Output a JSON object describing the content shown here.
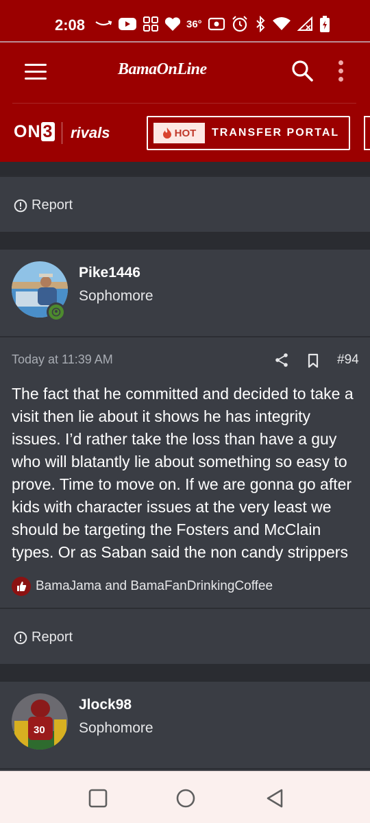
{
  "status_bar": {
    "time": "2:08",
    "temperature": "36°",
    "icons": [
      "amazon-icon",
      "youtube-icon",
      "apps-icon",
      "heart-icon",
      "temperature",
      "radio-icon",
      "alarm-icon",
      "bluetooth-icon",
      "wifi-icon",
      "signal-icon",
      "battery-icon"
    ]
  },
  "header": {
    "brand": "BamaOnLine",
    "on3_logo": "ON",
    "on3_logo_suffix": "3",
    "rivals_logo": "rivals",
    "hot_badge": "HOT",
    "transfer_portal_label": "TRANSFER PORTAL"
  },
  "report_label": "Report",
  "posts": [
    {
      "username": "Pike1446",
      "user_title": "Sophomore",
      "timestamp": "Today at 11:39 AM",
      "post_number": "#94",
      "body": "The fact that he committed and decided to take a visit then lie about it shows he has integrity issues. I’d rather take the loss than have a guy who will blatantly lie about something so easy to prove. Time to move on. If we are gonna go after kids with character issues at the very least we should be targeting the Fosters and McClain types. Or as Saban said the non candy strippers",
      "reactions_text": "BamaJama and BamaFanDrinkingCoffee"
    },
    {
      "username": "Jlock98",
      "user_title": "Sophomore",
      "jersey_number": "30"
    }
  ],
  "colors": {
    "brand_red": "#9b0000",
    "card_bg": "#3a3d44",
    "page_bg": "#2f3238",
    "online_green": "#4d8a2e"
  },
  "nav_bar": [
    "recents-icon",
    "home-icon",
    "back-icon"
  ]
}
